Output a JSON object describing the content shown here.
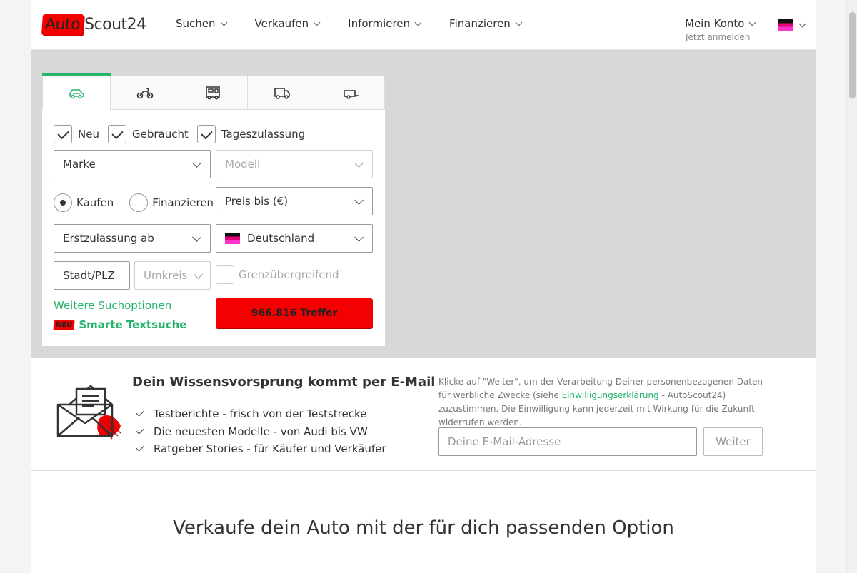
{
  "header": {
    "logo_left": "Auto",
    "logo_right": "Scout24",
    "nav": [
      {
        "label": "Suchen"
      },
      {
        "label": "Verkaufen"
      },
      {
        "label": "Informieren"
      },
      {
        "label": "Finanzieren"
      }
    ],
    "account_title": "Mein Konto",
    "account_sub": "Jetzt anmelden",
    "flag_icon": "flag-icon"
  },
  "search": {
    "vehicle_tabs": [
      {
        "icon": "car-icon",
        "active": true
      },
      {
        "icon": "motorbike-icon",
        "active": false
      },
      {
        "icon": "camper-icon",
        "active": false
      },
      {
        "icon": "van-icon",
        "active": false
      },
      {
        "icon": "trailer-icon",
        "active": false
      }
    ],
    "checkboxes": [
      {
        "label": "Neu",
        "checked": true
      },
      {
        "label": "Gebraucht",
        "checked": true
      },
      {
        "label": "Tageszulassung",
        "checked": true
      }
    ],
    "make_select": "Marke",
    "model_select": "Modell",
    "radios": [
      {
        "label": "Kaufen",
        "selected": true
      },
      {
        "label": "Finanzieren",
        "selected": false
      }
    ],
    "price_select": "Preis bis (€)",
    "registration_select": "Erstzulassung ab",
    "country_select": "Deutschland",
    "city_input": "Stadt/PLZ",
    "radius_select": "Umkreis",
    "cross_border": "Grenzübergreifend",
    "more_options": "Weitere Suchoptionen",
    "smart_badge": "NEU",
    "smart_search": "Smarte Textsuche",
    "results_button": "966.816 Treffer"
  },
  "newsletter": {
    "title": "Dein Wissensvorsprung kommt per E-Mail",
    "bullets": [
      "Testberichte - frisch von der Teststrecke",
      "Die neuesten Modelle - von Audi bis VW",
      "Ratgeber Stories - für Käufer und Verkäufer"
    ],
    "note_part1": "Klicke auf \"Weiter\", um der Verarbeitung Deiner personenbezogenen Daten für werbliche Zwecke (siehe ",
    "note_link": "Einwilligungserklärung",
    "note_part2": " - AutoScout24) zuzustimmen. Die Einwilligung kann jederzeit mit Wirkung für die Zukunft widerrufen werden.",
    "email_placeholder": "Deine E-Mail-Adresse",
    "submit": "Weiter"
  },
  "sell": {
    "title": "Verkaufe dein Auto mit der für dich passenden Option"
  },
  "colors": {
    "brand_red": "#f50000",
    "accent_green": "#26b36b",
    "hero_bg": "#d8d8d8"
  }
}
